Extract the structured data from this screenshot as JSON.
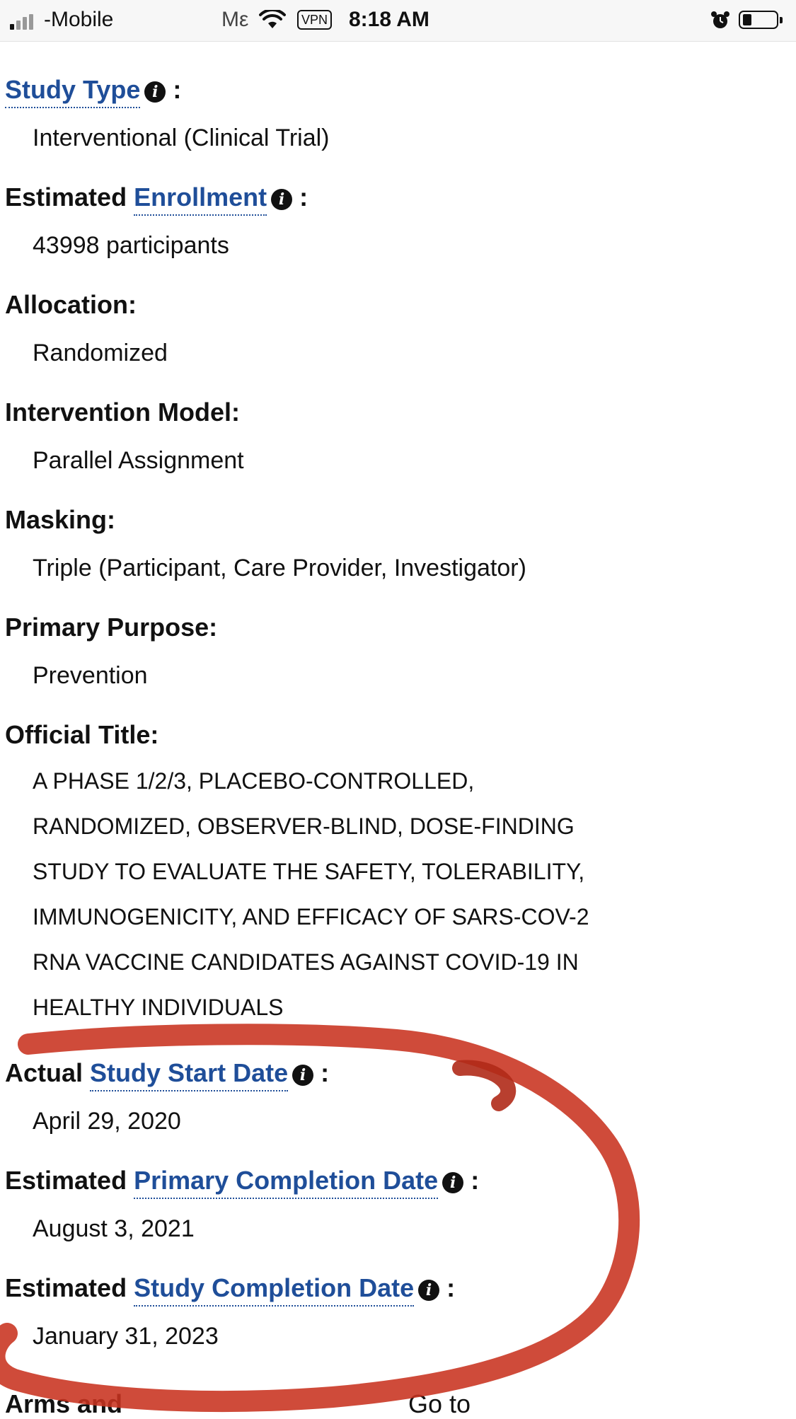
{
  "status_bar": {
    "carrier": "-Mobile",
    "me_label": "Mε",
    "vpn": "VPN",
    "time": "8:18 AM"
  },
  "fields": {
    "study_type": {
      "label_link": "Study Type",
      "suffix": ":",
      "value": "Interventional  (Clinical Trial)"
    },
    "enrollment": {
      "label_prefix": "Estimated",
      "label_link": "Enrollment",
      "suffix": ":",
      "value": "43998 participants"
    },
    "allocation": {
      "label": "Allocation:",
      "value": "Randomized"
    },
    "intervention_model": {
      "label": "Intervention Model:",
      "value": "Parallel Assignment"
    },
    "masking": {
      "label": "Masking:",
      "value": "Triple (Participant, Care Provider, Investigator)"
    },
    "primary_purpose": {
      "label": "Primary Purpose:",
      "value": "Prevention"
    },
    "official_title": {
      "label": "Official Title:",
      "lines": [
        "A PHASE 1/2/3, PLACEBO-CONTROLLED,",
        "RANDOMIZED, OBSERVER-BLIND, DOSE-FINDING",
        "STUDY TO EVALUATE THE SAFETY, TOLERABILITY,",
        "IMMUNOGENICITY, AND EFFICACY OF SARS-COV-2",
        "RNA VACCINE CANDIDATES AGAINST COVID-19 IN",
        "HEALTHY INDIVIDUALS"
      ]
    },
    "study_start": {
      "label_prefix": "Actual",
      "label_link": "Study Start Date",
      "suffix": ":",
      "value": "April 29, 2020"
    },
    "primary_completion": {
      "label_prefix": "Estimated",
      "label_link": "Primary Completion Date",
      "suffix": ":",
      "value": "August 3, 2021"
    },
    "study_completion": {
      "label_prefix": "Estimated",
      "label_link": "Study Completion Date",
      "suffix": ":",
      "value": "January 31, 2023"
    }
  },
  "bottom": {
    "arms_label": "Arms and",
    "goto_label": "Go to"
  },
  "annotation_color": "#c8321f",
  "info_icon": "info-circle-icon"
}
